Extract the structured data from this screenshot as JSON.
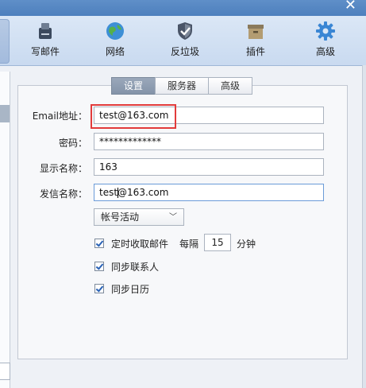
{
  "window": {
    "close_glyph": "✕"
  },
  "toolbar": {
    "items": [
      {
        "label": "写邮件",
        "icon": "compose-icon"
      },
      {
        "label": "网络",
        "icon": "globe-icon"
      },
      {
        "label": "反垃圾",
        "icon": "shield-icon"
      },
      {
        "label": "插件",
        "icon": "plugin-box-icon"
      },
      {
        "label": "高级",
        "icon": "gear-icon"
      }
    ]
  },
  "tabs": [
    {
      "label": "设置",
      "active": true
    },
    {
      "label": "服务器",
      "active": false
    },
    {
      "label": "高级",
      "active": false
    }
  ],
  "form": {
    "email": {
      "label": "Email地址：",
      "value": "test@163.com"
    },
    "password": {
      "label": "密码：",
      "value": "*************"
    },
    "display_name": {
      "label": "显示名称：",
      "value": "163"
    },
    "sender_name": {
      "label": "发信名称：",
      "value_before_caret": "test",
      "value_after_caret": "@163.com"
    },
    "account_status": {
      "selected": "帐号活动",
      "arrow": "﹀"
    },
    "options": {
      "auto_fetch": {
        "label": "定时收取邮件",
        "checked": true
      },
      "interval_prefix": "每隔",
      "interval_value": "15",
      "interval_unit": "分钟",
      "sync_contacts": {
        "label": "同步联系人",
        "checked": true
      },
      "sync_calendar": {
        "label": "同步日历",
        "checked": true
      }
    }
  },
  "colors": {
    "accent": "#4d7fbd",
    "highlight_box": "#e23b3b",
    "check": "#2b63b6"
  }
}
